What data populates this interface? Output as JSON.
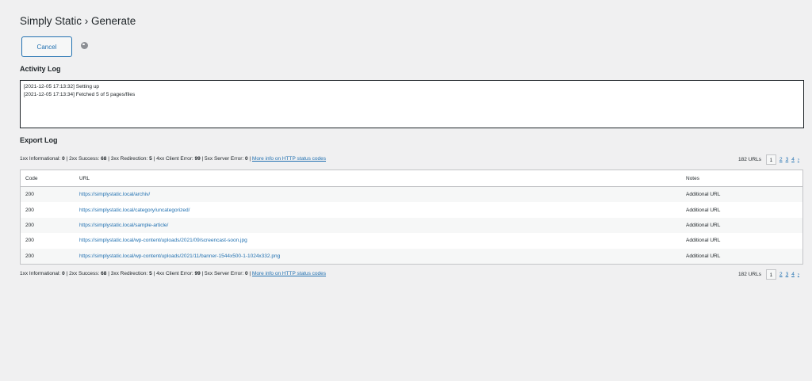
{
  "header": {
    "title": "Simply Static › Generate"
  },
  "toolbar": {
    "cancel_label": "Cancel"
  },
  "activity_log": {
    "title": "Activity Log",
    "lines": [
      "[2021-12-05 17:13:32] Setting up",
      "[2021-12-05 17:13:34] Fetched 5 of 5 pages/files"
    ]
  },
  "export_log": {
    "title": "Export Log",
    "status": {
      "informational_label": "1xx Informational:",
      "informational": "0",
      "success_label": "2xx Success:",
      "success": "68",
      "redirection_label": "3xx Redirection:",
      "redirection": "5",
      "client_error_label": "4xx Client Error:",
      "client_error": "99",
      "server_error_label": "5xx Server Error:",
      "server_error": "0",
      "more_info": "More info on HTTP status codes"
    },
    "pagination": {
      "total": "182 URLs",
      "current": "1",
      "pages": [
        "2",
        "3",
        "4"
      ],
      "next": "›"
    },
    "columns": {
      "code": "Code",
      "url": "URL",
      "notes": "Notes"
    },
    "rows": [
      {
        "code": "200",
        "url": "https://simplystatic.local/archiv/",
        "notes": "Additional URL"
      },
      {
        "code": "200",
        "url": "https://simplystatic.local/category/uncategorized/",
        "notes": "Additional URL"
      },
      {
        "code": "200",
        "url": "https://simplystatic.local/sample-article/",
        "notes": "Additional URL"
      },
      {
        "code": "200",
        "url": "https://simplystatic.local/wp-content/uploads/2021/09/screencast-soon.jpg",
        "notes": "Additional URL"
      },
      {
        "code": "200",
        "url": "https://simplystatic.local/wp-content/uploads/2021/11/banner-1544x500-1-1024x332.png",
        "notes": "Additional URL"
      }
    ]
  },
  "colors": {
    "link": "#2271b1",
    "background": "#f0f0f1"
  }
}
